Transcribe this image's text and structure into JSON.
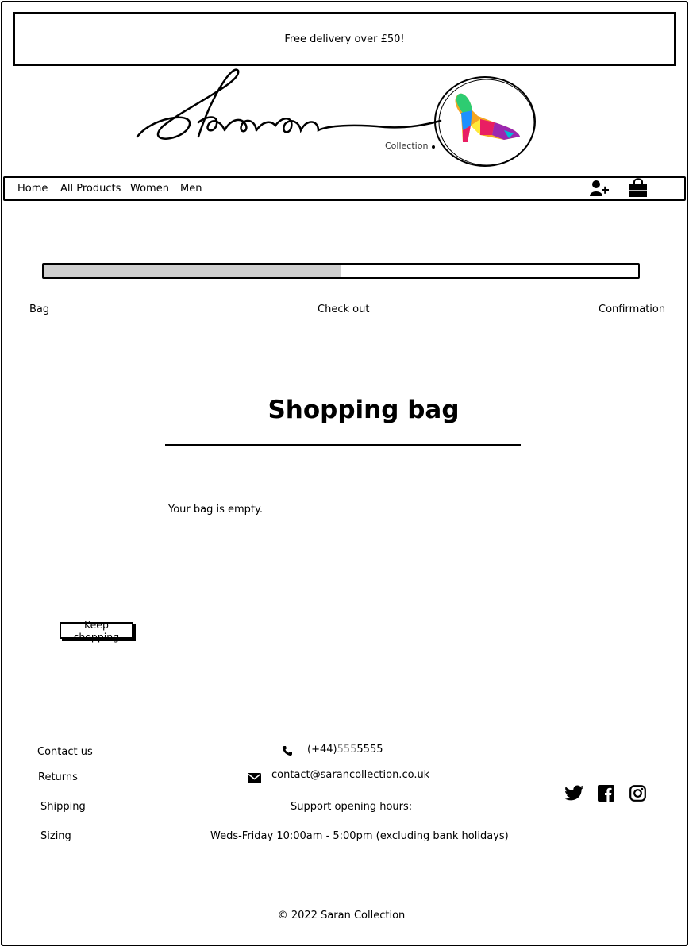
{
  "promo": {
    "text": "Free delivery over £50!"
  },
  "brand": {
    "logo_text": "Saran",
    "logo_sub": "Collection"
  },
  "nav": {
    "items": [
      {
        "label": "Home"
      },
      {
        "label": "All Products"
      },
      {
        "label": "Women"
      },
      {
        "label": "Men"
      }
    ],
    "account_icon": "user-plus-icon",
    "bag_icon": "shopping-bag-icon"
  },
  "checkout_progress": {
    "fraction_complete": 0.5,
    "steps": [
      "Bag",
      "Check out",
      "Confirmation"
    ],
    "fill_color": "#cfcfcf"
  },
  "main": {
    "title": "Shopping bag",
    "empty_message": "Your bag is empty.",
    "keep_shopping_label": "Keep shopping"
  },
  "footer": {
    "links": [
      "Contact us",
      "Returns",
      "Shipping",
      "Sizing"
    ],
    "phone_prefix": "(+44)",
    "phone_masked": "555",
    "phone_suffix": "5555",
    "email": "contact@sarancollection.co.uk",
    "support_heading": "Support opening hours:",
    "support_hours": "Weds-Friday 10:00am - 5:00pm (excluding bank holidays)",
    "social_icons": [
      "twitter-icon",
      "facebook-icon",
      "instagram-icon"
    ],
    "copyright": "© 2022 Saran Collection"
  }
}
